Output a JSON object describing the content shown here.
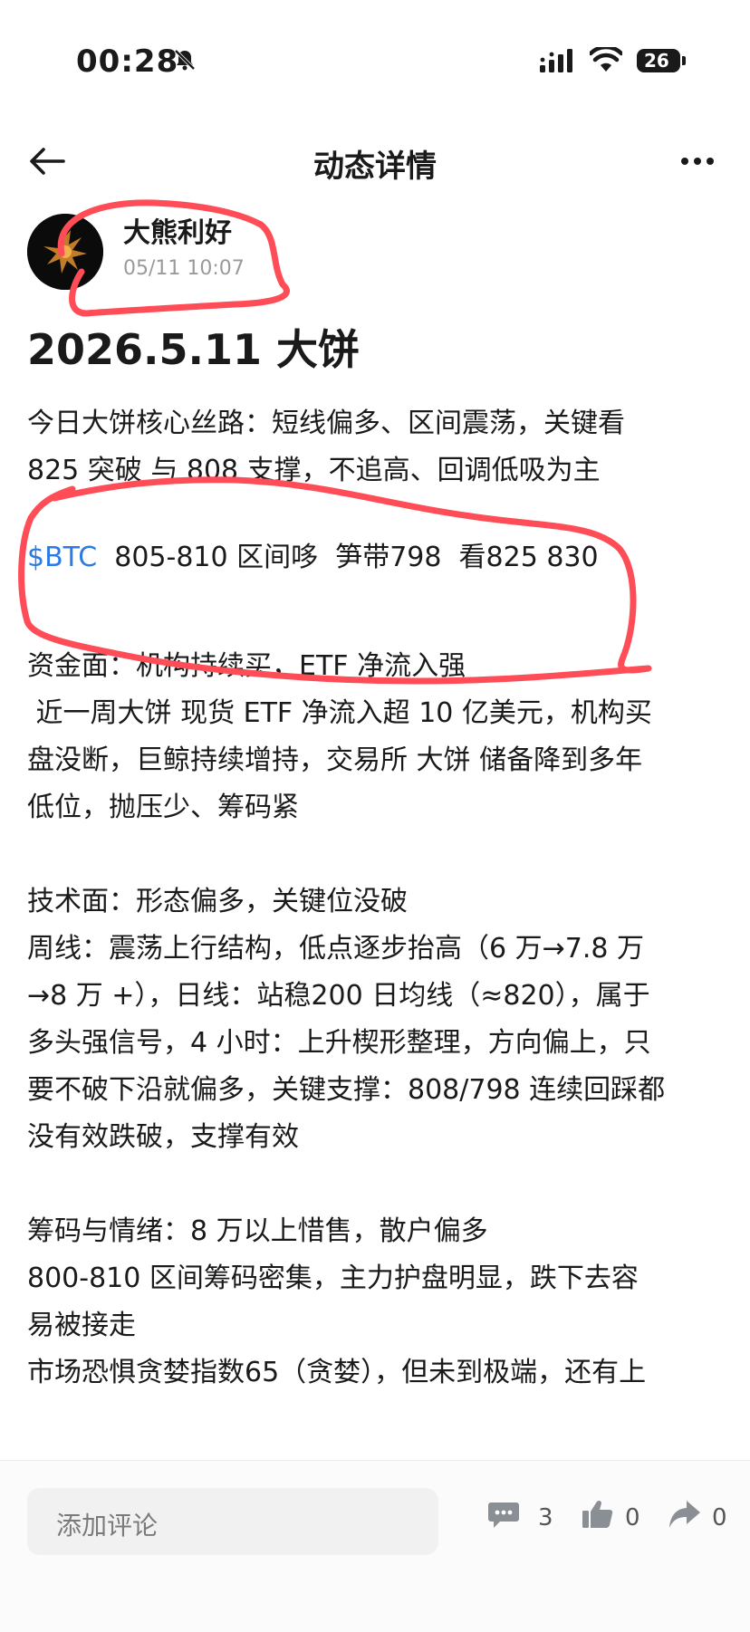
{
  "status_bar": {
    "time": "00:28",
    "battery": "26",
    "icons": [
      "bell-off-icon",
      "signal-icon",
      "wifi-icon",
      "battery-icon"
    ]
  },
  "nav": {
    "title": "动态详情",
    "back_icon": "arrow-left-icon",
    "more_icon": "more-dots-icon"
  },
  "author": {
    "name": "大熊利好",
    "time": "05/11 10:07"
  },
  "post": {
    "title": "2026.5.11 大饼",
    "lines": [
      "今日大饼核心丝路：短线偏多、区间震荡，关键看",
      "825 突破 与 808 支撑，不追高、回调低吸为主"
    ],
    "ticker": "$BTC",
    "ticker_rest": "  805-810 区间哆  笋带798  看825 830",
    "funds": [
      "资金面：机构持续买，ETF 净流入强",
      " 近一周大饼 现货 ETF 净流入超 10 亿美元，机构买",
      "盘没断，巨鲸持续增持，交易所 大饼 储备降到多年",
      "低位，抛压少、筹码紧"
    ],
    "tech": [
      "技术面：形态偏多，关键位没破",
      "周线：震荡上行结构，低点逐步抬高（6 万→7.8 万",
      "→8 万 +），日线：站稳200 日均线（≈820），属于",
      "多头强信号，4 小时：上升楔形整理，方向偏上，只",
      "要不破下沿就偏多，关键支撑：808/798 连续回踩都",
      "没有效跌破，支撑有效"
    ],
    "chips": [
      "筹码与情绪：8 万以上惜售，散户偏多",
      "800-810 区间筹码密集，主力护盘明显，跌下去容",
      "易被接走",
      "市场恐惧贪婪指数65（贪婪），但未到极端，还有上"
    ]
  },
  "bottom": {
    "comment_placeholder": "添加评论",
    "comments": "3",
    "likes": "0",
    "shares": "0",
    "icons": [
      "comment-icon",
      "thumbs-up-icon",
      "share-icon"
    ]
  },
  "colors": {
    "link": "#2c7be5",
    "annotation": "#ff4d57",
    "text": "#1a1a1a"
  }
}
